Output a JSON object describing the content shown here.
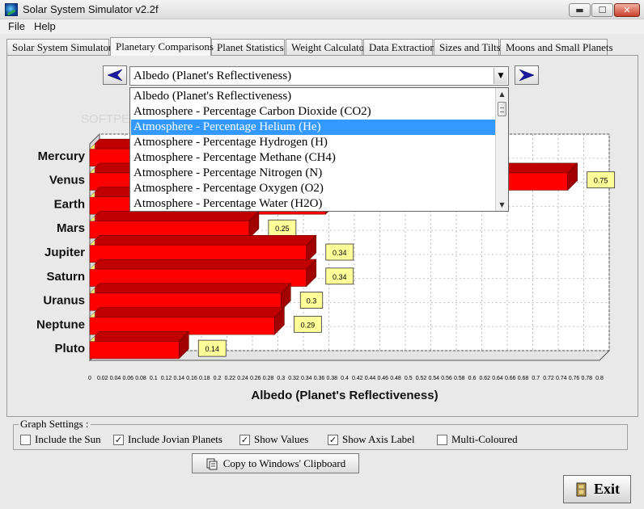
{
  "window": {
    "title": "Solar System Simulator v2.2f",
    "minimize_glyph": "▬",
    "maximize_glyph": "☐",
    "close_glyph": "✕"
  },
  "menu": {
    "items": [
      {
        "label": "File"
      },
      {
        "label": "Help"
      }
    ]
  },
  "tabs": [
    {
      "label": "Solar System Simulator"
    },
    {
      "label": "Planetary Comparisons",
      "active": true
    },
    {
      "label": "Planet Statistics"
    },
    {
      "label": "Weight Calculator"
    },
    {
      "label": "Data Extraction"
    },
    {
      "label": "Sizes and Tilts"
    },
    {
      "label": "Moons and Small Planets"
    }
  ],
  "selector": {
    "value": "Albedo (Planet's Reflectiveness)",
    "prev_icon": "arrow-left-icon",
    "next_icon": "arrow-right-icon",
    "options": [
      "Albedo (Planet's Reflectiveness)",
      "Atmosphere - Percentage Carbon Dioxide (CO2)",
      "Atmosphere - Percentage Helium (He)",
      "Atmosphere - Percentage Hydrogen (H)",
      "Atmosphere - Percentage Methane (CH4)",
      "Atmosphere - Percentage Nitrogen (N)",
      "Atmosphere - Percentage Oxygen (O2)",
      "Atmosphere - Percentage Water (H2O)"
    ],
    "highlighted_index": 2
  },
  "chart_data": {
    "type": "bar",
    "orientation": "horizontal",
    "categories": [
      "Mercury",
      "Venus",
      "Earth",
      "Mars",
      "Jupiter",
      "Saturn",
      "Uranus",
      "Neptune",
      "Pluto"
    ],
    "values": [
      0.11,
      0.75,
      0.37,
      0.25,
      0.34,
      0.34,
      0.3,
      0.29,
      0.14
    ],
    "value_labels": [
      "",
      "0.75",
      "",
      "0.25",
      "0.34",
      "0.34",
      "0.3",
      "0.29",
      "0.14"
    ],
    "xlabel": "Albedo (Planet's Reflectiveness)",
    "xlim": [
      0,
      0.8
    ],
    "xticks": [
      "0",
      "0.02",
      "0.04",
      "0.06",
      "0.08",
      "0.1",
      "0.12",
      "0.14",
      "0.16",
      "0.18",
      "0.2",
      "0.22",
      "0.24",
      "0.26",
      "0.28",
      "0.3",
      "0.32",
      "0.34",
      "0.36",
      "0.38",
      "0.4",
      "0.42",
      "0.44",
      "0.46",
      "0.48",
      "0.5",
      "0.52",
      "0.54",
      "0.56",
      "0.58",
      "0.6",
      "0.62",
      "0.64",
      "0.66",
      "0.68",
      "0.7",
      "0.72",
      "0.74",
      "0.76",
      "0.78",
      "0.8"
    ],
    "grid": true,
    "bar_color": "#ff0000",
    "bar_dark": "#c00000",
    "label_bg": "#ffff99"
  },
  "graph_settings": {
    "title": "Graph Settings :",
    "options": [
      {
        "label": "Include the Sun",
        "checked": false
      },
      {
        "label": "Include Jovian Planets",
        "checked": true
      },
      {
        "label": "Show Values",
        "checked": true
      },
      {
        "label": "Show Axis Label",
        "checked": true
      },
      {
        "label": "Multi-Coloured",
        "checked": false
      }
    ]
  },
  "buttons": {
    "copy_label": "Copy to Windows' Clipboard",
    "exit_label": "Exit"
  },
  "watermark": "SOFTPEDIA"
}
